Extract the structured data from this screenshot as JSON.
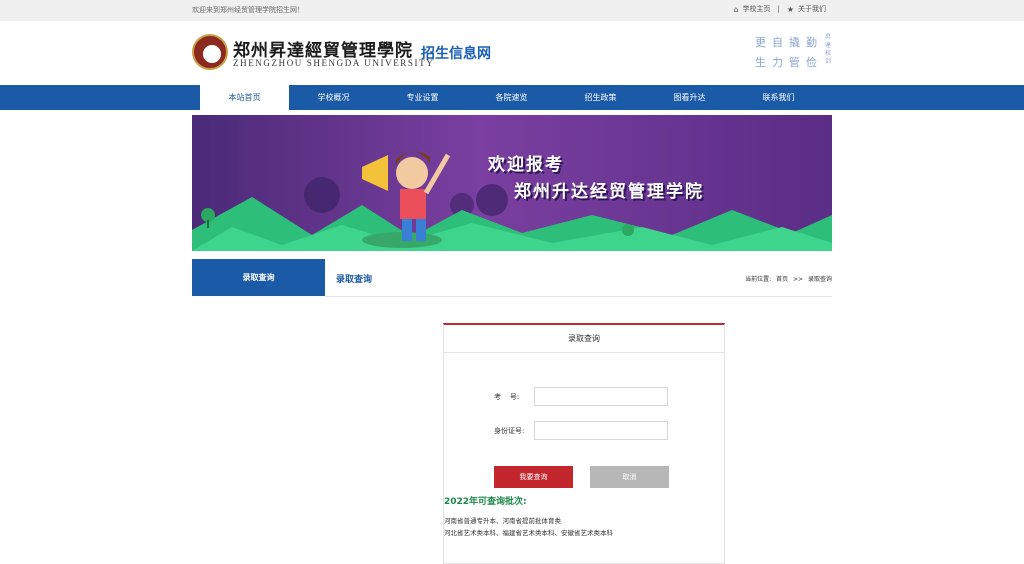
{
  "topbar": {
    "welcome": "欢迎来到郑州经贸管理学院招生网！",
    "home_label": "学校主页",
    "separator": "|",
    "about_label": "关于我们"
  },
  "header": {
    "logo_cn": "郑州昇達經貿管理學院",
    "logo_en": "ZHENGZHOU SHENGDA UNIVERSITY",
    "site_title": "招生信息网",
    "motto_line1": "更自撬勤",
    "motto_line2": "生力管俭",
    "motto_side_left": "昇達",
    "motto_side_right": "昇達校训"
  },
  "nav": {
    "items": [
      {
        "label": "本站首页"
      },
      {
        "label": "学校概况"
      },
      {
        "label": "专业设置"
      },
      {
        "label": "各院速览"
      },
      {
        "label": "招生政策"
      },
      {
        "label": "图看升达"
      },
      {
        "label": "联系我们"
      }
    ]
  },
  "banner": {
    "line1": "欢迎报考",
    "line2": "郑州升达经贸管理学院"
  },
  "section": {
    "side_title": "录取查询",
    "content_title": "录取查询",
    "breadcrumb_prefix": "当前位置:",
    "breadcrumb_home": "首页",
    "breadcrumb_sep": ">>",
    "breadcrumb_current": "录取查询"
  },
  "form": {
    "title": "录取查询",
    "exam_label": "考    号:",
    "id_label": "身份证号:",
    "exam_value": "",
    "id_value": "",
    "query_button": "我要查询",
    "cancel_button": "取消"
  },
  "batches": {
    "title": "2022年可查询批次:",
    "lines": [
      "河南省普通专升本、河南省提前批体育类",
      "河北省艺术类本科、福建省艺术类本科、安徽省艺术类本科"
    ]
  },
  "colors": {
    "primary_blue": "#1b5aa6",
    "accent_red": "#c1272d",
    "batch_green": "#1a8a4a"
  }
}
